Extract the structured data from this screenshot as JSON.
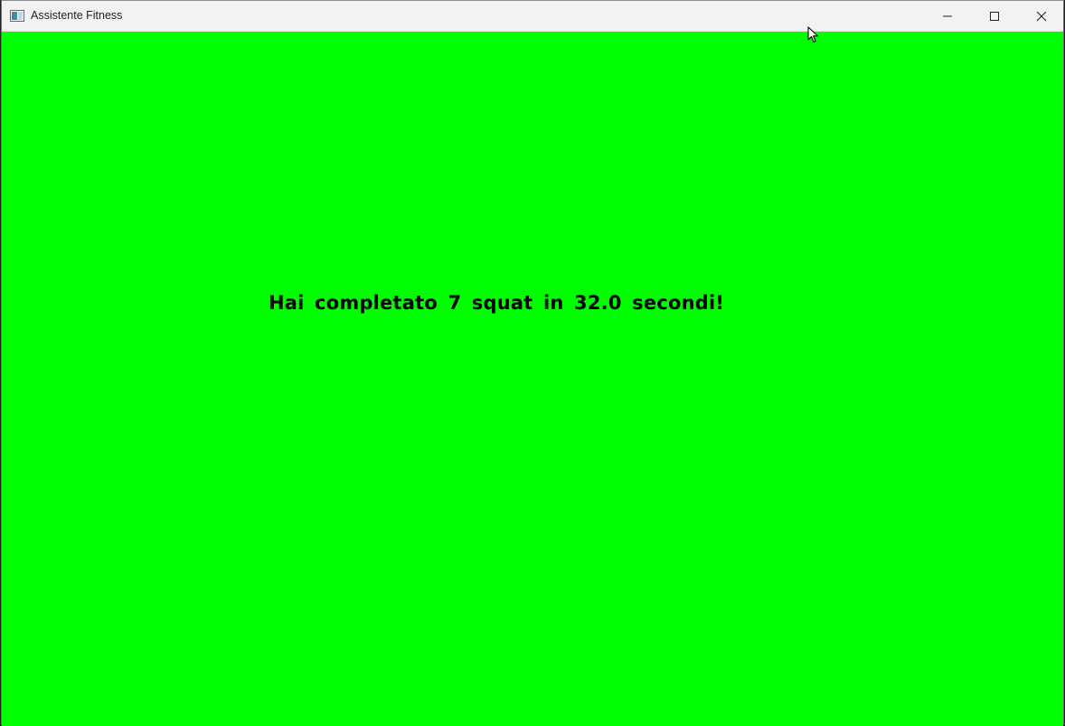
{
  "window": {
    "title": "Assistente Fitness",
    "background_color": "#00ff00",
    "titlebar_color": "#f2f2f2"
  },
  "titlebar": {
    "app_icon": "app-window-icon",
    "buttons": {
      "minimize_icon": "minimize-icon",
      "maximize_icon": "maximize-icon",
      "close_icon": "close-icon"
    }
  },
  "content": {
    "message": "Hai completato 7 squat in 32.0 secondi!",
    "text_color": "#000000"
  },
  "cursor": {
    "icon": "mouse-pointer-icon"
  }
}
